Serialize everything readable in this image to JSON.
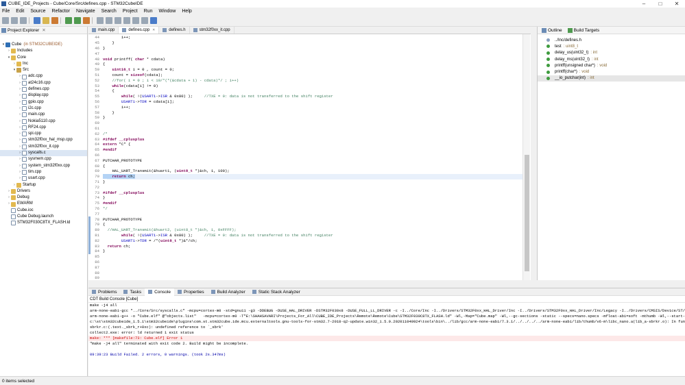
{
  "window": {
    "title": "CUBE_IDE_Projects - Cube/Core/Src/defines.cpp - STM32CubeIDE",
    "minimize": "–",
    "maximize": "□",
    "close": "✕"
  },
  "menu": [
    "File",
    "Edit",
    "Source",
    "Refactor",
    "Navigate",
    "Search",
    "Project",
    "Run",
    "Window",
    "Help"
  ],
  "explorer": {
    "title": "Project Explorer",
    "items": [
      {
        "label": "Cube",
        "decoration": "(in STM32CUBEIDE)",
        "depth": 0,
        "tw": "▾",
        "icon": "i-proj"
      },
      {
        "label": "Includes",
        "depth": 1,
        "tw": "›",
        "icon": "i-folder"
      },
      {
        "label": "Core",
        "depth": 1,
        "tw": "▾",
        "icon": "i-folder"
      },
      {
        "label": "Inc",
        "depth": 2,
        "tw": "›",
        "icon": "i-folder"
      },
      {
        "label": "Src",
        "depth": 2,
        "tw": "▾",
        "icon": "i-src"
      },
      {
        "label": "adc.cpp",
        "depth": 3,
        "tw": "›",
        "icon": "i-file"
      },
      {
        "label": "at24c16.cpp",
        "depth": 3,
        "tw": "›",
        "icon": "i-file"
      },
      {
        "label": "defines.cpp",
        "depth": 3,
        "tw": "›",
        "icon": "i-file"
      },
      {
        "label": "display.cpp",
        "depth": 3,
        "tw": "›",
        "icon": "i-file"
      },
      {
        "label": "gpio.cpp",
        "depth": 3,
        "tw": "›",
        "icon": "i-file"
      },
      {
        "label": "i2c.cpp",
        "depth": 3,
        "tw": "›",
        "icon": "i-file"
      },
      {
        "label": "main.cpp",
        "depth": 3,
        "tw": "›",
        "icon": "i-file"
      },
      {
        "label": "Nokia5110.cpp",
        "depth": 3,
        "tw": "›",
        "icon": "i-file"
      },
      {
        "label": "RF24.cpp",
        "depth": 3,
        "tw": "›",
        "icon": "i-file"
      },
      {
        "label": "spi.cpp",
        "depth": 3,
        "tw": "›",
        "icon": "i-file"
      },
      {
        "label": "stm32f0xx_hal_msp.cpp",
        "depth": 3,
        "tw": "›",
        "icon": "i-file"
      },
      {
        "label": "stm32f0xx_it.cpp",
        "depth": 3,
        "tw": "›",
        "icon": "i-file"
      },
      {
        "label": "syscalls.c",
        "depth": 3,
        "tw": "›",
        "icon": "i-file"
      },
      {
        "label": "sysmem.cpp",
        "depth": 3,
        "tw": "›",
        "icon": "i-file"
      },
      {
        "label": "system_stm32f0xx.cpp",
        "depth": 3,
        "tw": "›",
        "icon": "i-file"
      },
      {
        "label": "tim.cpp",
        "depth": 3,
        "tw": "›",
        "icon": "i-file"
      },
      {
        "label": "usart.cpp",
        "depth": 3,
        "tw": "›",
        "icon": "i-file"
      },
      {
        "label": "Startup",
        "depth": 2,
        "tw": "›",
        "icon": "i-folder"
      },
      {
        "label": "Drivers",
        "depth": 1,
        "tw": "›",
        "icon": "i-folder"
      },
      {
        "label": "Debug",
        "depth": 1,
        "tw": "›",
        "icon": "i-folder"
      },
      {
        "label": "EWARM",
        "depth": 1,
        "tw": "›",
        "icon": "i-folder"
      },
      {
        "label": "Cube.ioc",
        "depth": 1,
        "tw": "",
        "icon": "i-file"
      },
      {
        "label": "Cube Debug.launch",
        "depth": 1,
        "tw": "",
        "icon": "i-file"
      },
      {
        "label": "STM32F030C8TX_FLASH.ld",
        "depth": 1,
        "tw": "",
        "icon": "i-file"
      }
    ]
  },
  "editor_tabs": [
    {
      "label": "main.cpp",
      "active": false
    },
    {
      "label": "defines.cpp",
      "active": true
    },
    {
      "label": "defines.h",
      "active": false
    },
    {
      "label": "stm32f0xx_it.cpp",
      "active": false
    }
  ],
  "code": [
    {
      "n": "44",
      "t": "        i++;"
    },
    {
      "n": "45",
      "t": "    }"
    },
    {
      "n": "46",
      "t": "}"
    },
    {
      "n": "47",
      "t": ""
    },
    {
      "n": "48",
      "t": "void printff( char * cdata)"
    },
    {
      "n": "49",
      "t": "{"
    },
    {
      "n": "50",
      "t": "    uint16_t i = 0 , count = 0;"
    },
    {
      "n": "51",
      "t": "    count = sizeof(cdata);"
    },
    {
      "n": "52",
      "t": "    //for( i = 0 ; i < 10/*(*(&cdata + 1) - cdata)*/ ; i++)"
    },
    {
      "n": "53",
      "t": "    while(cdata[i] != 0)"
    },
    {
      "n": "54",
      "t": "    {"
    },
    {
      "n": "55",
      "t": "        while( !(USART1->ISR & 0x80) );     //TXE = 0: data is not transferred to the shift register"
    },
    {
      "n": "56",
      "t": "        USART1->TDR = cdata[i];"
    },
    {
      "n": "57",
      "t": "        i++;"
    },
    {
      "n": "58",
      "t": "    }"
    },
    {
      "n": "59",
      "t": "}"
    },
    {
      "n": "60",
      "t": ""
    },
    {
      "n": "61",
      "t": ""
    },
    {
      "n": "62",
      "t": "/*"
    },
    {
      "n": "63",
      "t": "#ifdef __cplusplus"
    },
    {
      "n": "64",
      "t": "extern \"C\" {"
    },
    {
      "n": "65",
      "t": "#endif"
    },
    {
      "n": "66",
      "t": ""
    },
    {
      "n": "67",
      "t": "PUTCHAR_PROTOTYPE"
    },
    {
      "n": "68",
      "t": "{"
    },
    {
      "n": "69",
      "t": "    HAL_UART_Transmit(&huart1, (uint8_t *)&ch, 1, 100);"
    },
    {
      "n": "70",
      "t": "    return ch;"
    },
    {
      "n": "71",
      "t": "}"
    },
    {
      "n": "72",
      "t": ""
    },
    {
      "n": "73",
      "t": "#ifdef __cplusplus"
    },
    {
      "n": "74",
      "t": "}"
    },
    {
      "n": "75",
      "t": "#endif"
    },
    {
      "n": "76",
      "t": "*/"
    },
    {
      "n": "77",
      "t": ""
    },
    {
      "n": "78",
      "t": "PUTCHAR_PROTOTYPE"
    },
    {
      "n": "79",
      "t": "{"
    },
    {
      "n": "80",
      "t": "  //HAL_UART_Transmit(&huart2, (uint8_t *)&ch, 1, 0xFFFF);"
    },
    {
      "n": "81",
      "t": "        while( !(USART1->ISR & 0x80) );     //TXE = 0: data is not transferred to the shift register"
    },
    {
      "n": "82",
      "t": "        USART1->TDR = /*(uint8_t *)&*/ch;"
    },
    {
      "n": "83",
      "t": "  return ch;"
    },
    {
      "n": "84",
      "t": "}"
    },
    {
      "n": "85",
      "t": ""
    },
    {
      "n": "86",
      "t": ""
    },
    {
      "n": "87",
      "t": ""
    },
    {
      "n": "88",
      "t": ""
    },
    {
      "n": "89",
      "t": ""
    }
  ],
  "highlight_line": "70",
  "outline": {
    "tabs": [
      "Outline",
      "Build Targets"
    ],
    "items": [
      {
        "label": "../Inc/defines.h",
        "type": ""
      },
      {
        "label": "test",
        "type": ": uint8_t"
      },
      {
        "label": "delay_us(uint32_t)",
        "type": ": int"
      },
      {
        "label": "delay_ms(uint32_t)",
        "type": ": int"
      },
      {
        "label": "printff(unsigned char*)",
        "type": ": void"
      },
      {
        "label": "printff(char*)",
        "type": ": void"
      },
      {
        "label": "__io_putchar(int)",
        "type": ": int"
      }
    ]
  },
  "bottom": {
    "tabs": [
      "Problems",
      "Tasks",
      "Console",
      "Properties",
      "Build Analyzer",
      "Static Stack Analyzer"
    ],
    "active_tab": "Console",
    "console_title": "CDT Build Console [Cube]",
    "lines": [
      {
        "t": "make -j4 all",
        "k": ""
      },
      {
        "t": "arm-none-eabi-gcc \"../Core/Src/syscalls.c\" -mcpu=cortex-m0 -std=gnu11 -g3 -DDEBUG -DUSE_HAL_DRIVER -DSTM32F030x8 -DUSE_FULL_LL_DRIVER -c -I../Core/Inc -I../Drivers/STM32F0xx_HAL_Driver/Inc -I../Drivers/STM32F0xx_HAL_Driver/Inc/Legacy -I../Drivers/CMSIS/Device/ST/STM32F0xx/Include -I../Drivers/CMSIS/Include -O0 -ffunction-sections -fdata-sections -Wall -fstack-usage -MMD -MP -MF\"Core/Src/syscalls.d\" -MT\"Core/Src/syscalls.o\" --specs=nano.specs -mfloat-abi=soft -mthumb -o \"Core/Src/syscalls.o\"",
        "k": ""
      },
      {
        "t": "arm-none-eabi-g++ -o \"Cube.elf\" @\"objects.list\"   -mcpu=cortex-m0 -T\"E:\\SHAHSAVARI\\Projects_For_All\\CUBE_IDE_Projects\\Remote\\Remote\\Cube\\STM32F030C8TX_FLASH.ld\" -Wl,-Map=\"Cube.map\" -Wl,--gc-sections -static --specs=nano.specs -mfloat-abi=soft -mthumb -Wl,--start-group -lc -lm -lstdc++ -lsupc++ -Wl,--end-group",
        "k": ""
      },
      {
        "t": "c:\\st\\stm32cubeide_1.5.1\\stm32cubeide\\plugins\\com.st.stm32cube.ide.mcu.externaltools.gnu-tools-for-stm32.7-2018-q2-update.win32_1.5.0.202011040924\\tools\\bin\\../lib/gcc/arm-none-eabi/7.3.1/../../../../arm-none-eabi/lib/thumb/v6-m\\libc_nano.a(lib_a-sbrkr.o): In function `_sbrk_r':",
        "k": ""
      },
      {
        "t": "sbrkr.c:(.text._sbrk_r+0xc): undefined reference to `_sbrk'",
        "k": ""
      },
      {
        "t": "collect2.exe: error: ld returned 1 exit status",
        "k": ""
      },
      {
        "t": "make: *** [makefile:73: Cube.elf] Error 1",
        "k": "err"
      },
      {
        "t": "\"make -j4 all\" terminated with exit code 2. Build might be incomplete.",
        "k": ""
      },
      {
        "t": "",
        "k": ""
      },
      {
        "t": "09:39:23 Build Failed. 2 errors, 0 warnings. (took 2s.347ms)",
        "k": "blue"
      }
    ]
  },
  "status": {
    "text": "0 items selected"
  }
}
